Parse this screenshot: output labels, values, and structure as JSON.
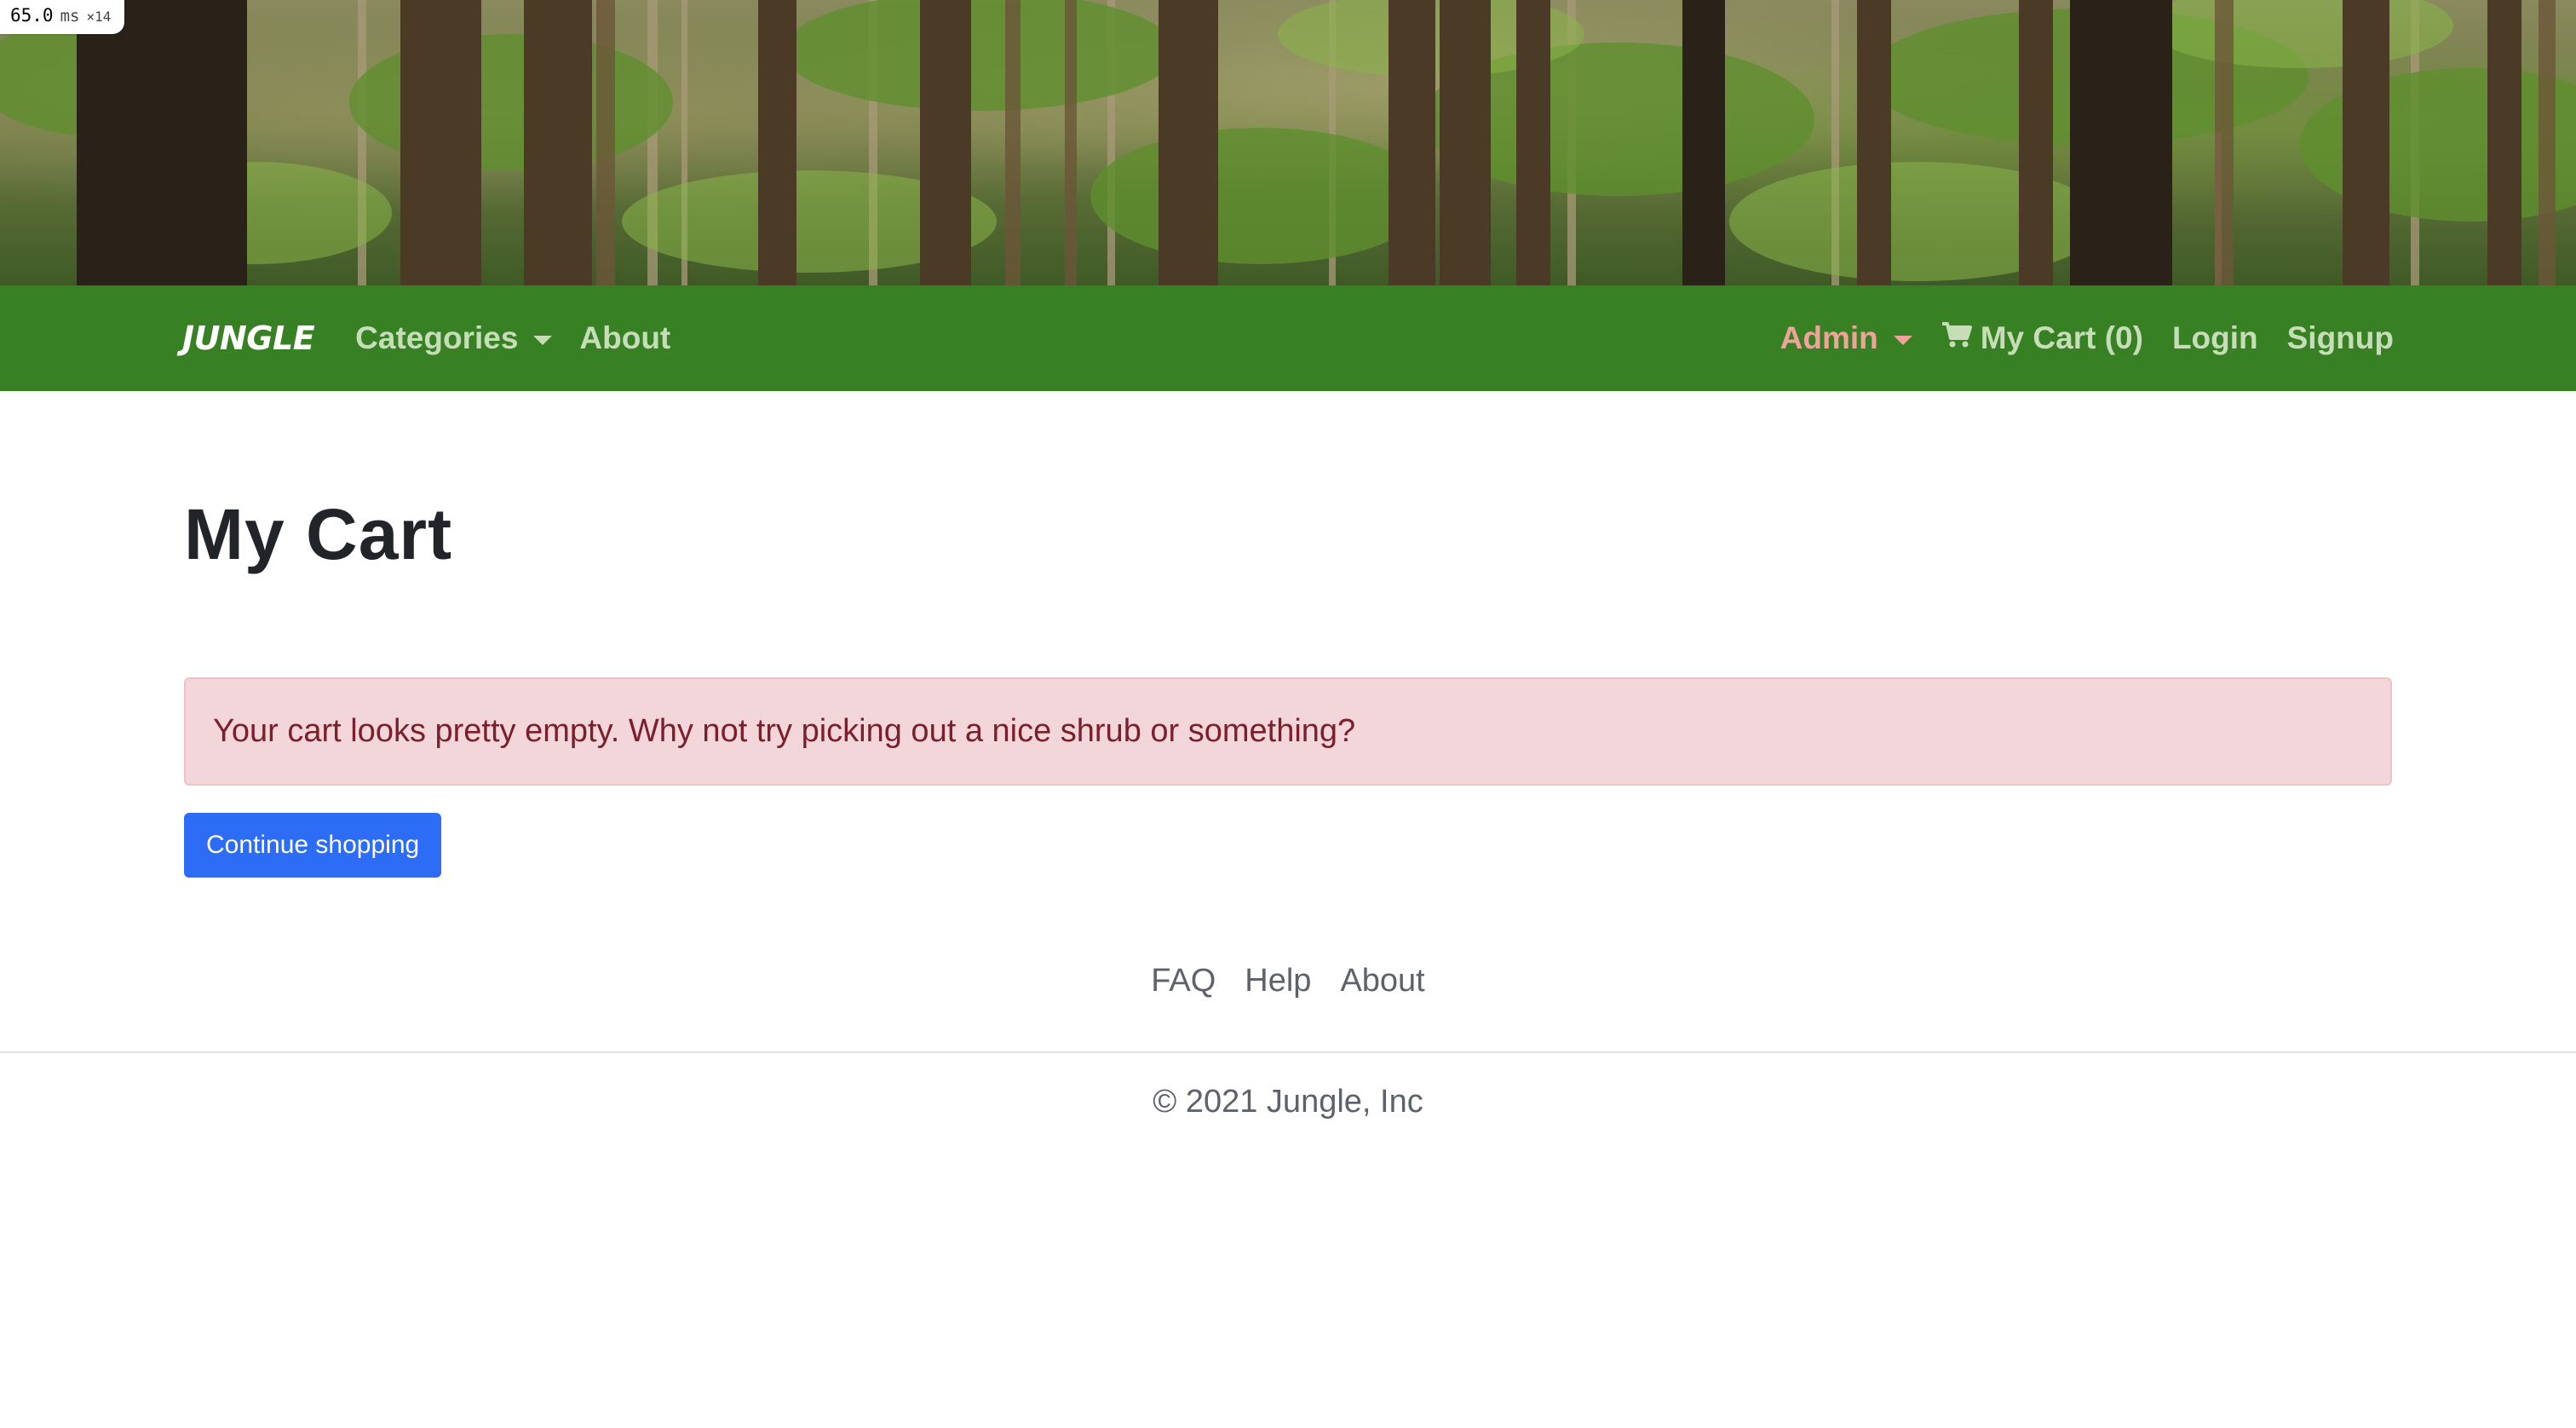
{
  "perf_badge": {
    "value": "65.0",
    "unit": "ms",
    "multiplier": "×14"
  },
  "hero": {
    "icon": "forest-banner-image"
  },
  "navbar": {
    "brand": "JUNGLE",
    "left_links": [
      {
        "label": "Categories",
        "has_dropdown": true
      },
      {
        "label": "About",
        "has_dropdown": false
      }
    ],
    "admin": {
      "label": "Admin",
      "has_dropdown": true
    },
    "cart": {
      "label": "My Cart (0)",
      "icon": "shopping-cart-icon"
    },
    "login": "Login",
    "signup": "Signup",
    "colors": {
      "background": "#388024",
      "link": "#c6ddb8",
      "admin": "#f0a39a",
      "brand": "#ffffff"
    }
  },
  "main": {
    "title": "My Cart",
    "alert": {
      "message": "Your cart looks pretty empty. Why not try picking out a nice shrub or something?",
      "background": "#f3d6d9",
      "text_color": "#7a1f2b"
    },
    "continue_button": {
      "label": "Continue shopping",
      "color": "#2d6cf5"
    }
  },
  "footer": {
    "links": [
      "FAQ",
      "Help",
      "About"
    ],
    "copyright": "© 2021 Jungle, Inc"
  }
}
